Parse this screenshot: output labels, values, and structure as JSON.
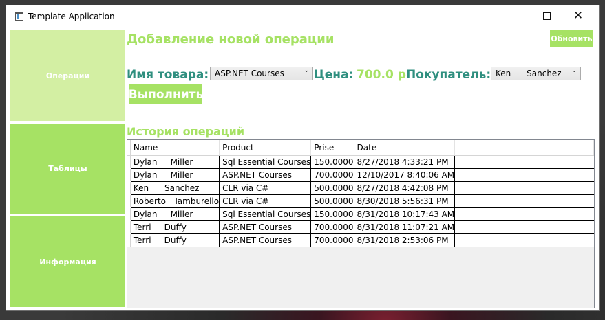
{
  "window": {
    "title": "Template Application",
    "minimize_icon": "minimize-icon",
    "maximize_icon": "maximize-icon",
    "close_icon": "close-icon"
  },
  "sidebar": {
    "items": [
      {
        "label": "Операции"
      },
      {
        "label": "Таблицы"
      },
      {
        "label": "Информация"
      }
    ]
  },
  "colors": {
    "accent_light": "#d3efa3",
    "accent": "#a6e264",
    "label_teal": "#2f8f7f"
  },
  "header": {
    "refresh_label": "Обновить",
    "add_title": "Добавление новой операции"
  },
  "form": {
    "product_label": "Имя товара:",
    "product_value": "ASP.NET Courses",
    "price_label": "Цена:",
    "price_value": "700.0 р",
    "buyer_label": "Покупатель:",
    "buyer_value": "Ken      Sanchez",
    "execute_label": "Выполнить"
  },
  "history": {
    "title": "История операций",
    "columns": [
      "Name",
      "Product",
      "Prise",
      "Date"
    ],
    "rows": [
      [
        "Dylan     Miller",
        "Sql Essential Courses",
        "150.0000",
        "8/27/2018 4:33:21 PM"
      ],
      [
        "Dylan     Miller",
        "ASP.NET Courses",
        "700.0000",
        "12/10/2017 8:40:06 AM"
      ],
      [
        "Ken      Sanchez",
        "CLR via C#",
        "500.0000",
        "8/27/2018 4:42:08 PM"
      ],
      [
        "Roberto   Tamburello",
        "CLR via C#",
        "500.0000",
        "8/30/2018 5:56:31 PM"
      ],
      [
        "Dylan     Miller",
        "Sql Essential Courses",
        "150.0000",
        "8/31/2018 10:17:43 AM"
      ],
      [
        "Terri     Duffy",
        "ASP.NET Courses",
        "700.0000",
        "8/31/2018 11:07:21 AM"
      ],
      [
        "Terri     Duffy",
        "ASP.NET Courses",
        "700.0000",
        "8/31/2018 2:53:06 PM"
      ]
    ]
  }
}
